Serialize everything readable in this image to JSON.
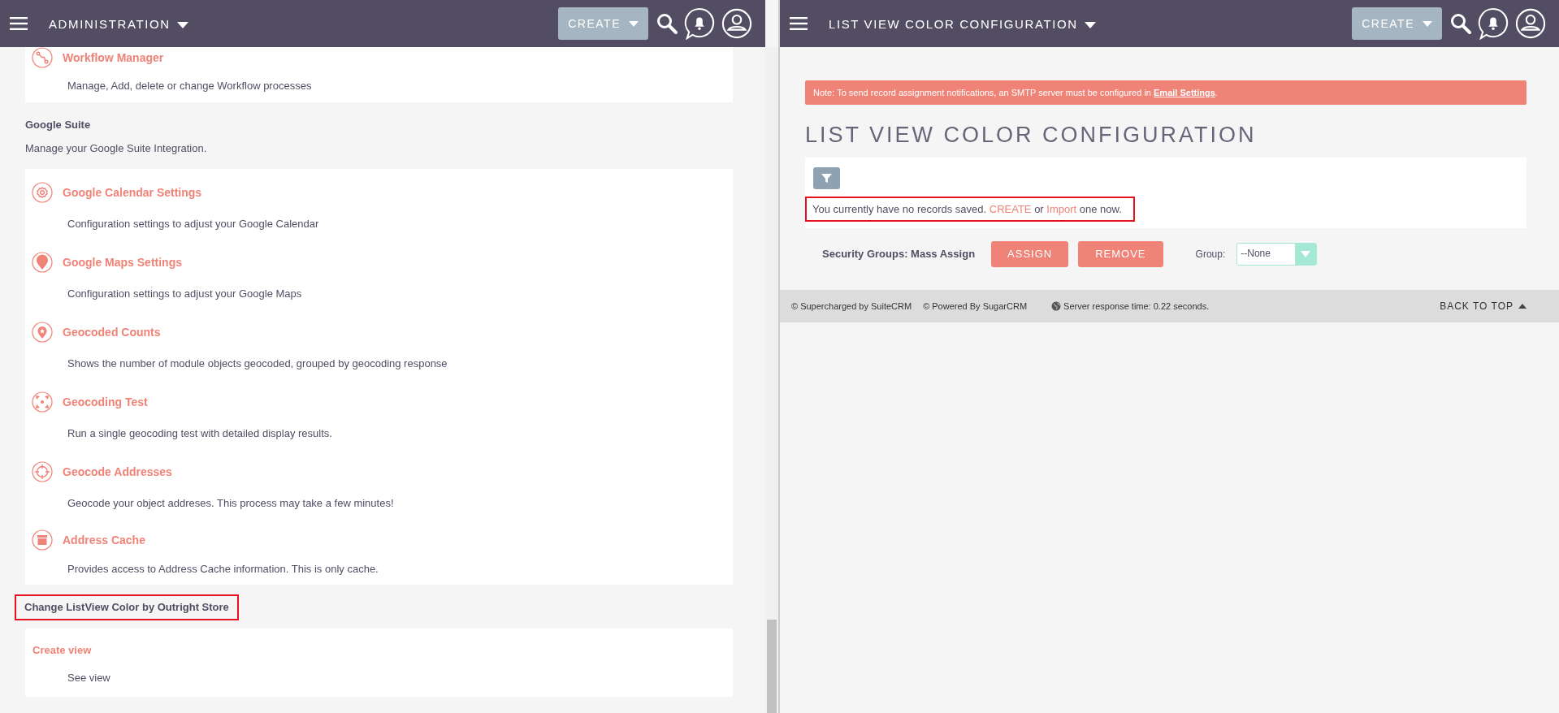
{
  "left": {
    "header": {
      "title": "ADMINISTRATION",
      "create": "CREATE"
    },
    "sections": [
      {
        "items": [
          {
            "kind": "workflow",
            "title": "Workflow Manager",
            "description": "Manage, Add, delete or change Workflow processes"
          }
        ]
      },
      {
        "title": "Google Suite",
        "description": "Manage your Google Suite Integration.",
        "items": [
          {
            "kind": "gear",
            "title": "Google Calendar Settings",
            "description": "Configuration settings to adjust your Google Calendar"
          },
          {
            "kind": "pin",
            "title": "Google Maps Settings",
            "description": "Configuration settings to adjust your Google Maps"
          },
          {
            "kind": "pin-star",
            "title": "Geocoded Counts",
            "description": "Shows the number of module objects geocoded, grouped by geocoding response"
          },
          {
            "kind": "arrows",
            "title": "Geocoding Test",
            "description": "Run a single geocoding test with detailed display results."
          },
          {
            "kind": "crosshair",
            "title": "Geocode Addresses",
            "description": "Geocode your object addreses. This process may take a few minutes!"
          },
          {
            "kind": "box",
            "title": "Address Cache",
            "description": "Provides access to Address Cache information. This is only cache."
          }
        ]
      },
      {
        "title": "Change ListView Color by Outright Store",
        "highlighted": true,
        "items": [
          {
            "kind": "none",
            "title": "Create view",
            "description": "See view"
          }
        ]
      }
    ]
  },
  "right": {
    "header": {
      "title": "LIST VIEW COLOR CONFIGURATION",
      "create": "CREATE"
    },
    "note": {
      "text": "Note: To send record assignment notifications, an SMTP server must be configured in ",
      "link": "Email Settings",
      "end": "."
    },
    "title": "LIST VIEW COLOR CONFIGURATION",
    "empty_message": {
      "highlighted": true,
      "parts": [
        {
          "kind": "text",
          "text": "You currently have no records saved. "
        },
        {
          "kind": "link",
          "text": "CREATE"
        },
        {
          "kind": "text",
          "text": " or "
        },
        {
          "kind": "link",
          "text": "Import"
        },
        {
          "kind": "text",
          "text": " one now."
        }
      ]
    },
    "mass_assign": {
      "label": "Security Groups: Mass Assign",
      "buttons": [
        "ASSIGN",
        "REMOVE"
      ],
      "group_label": "Group:",
      "group_value": "--None"
    },
    "footer": {
      "credits": [
        "© Supercharged by SuiteCRM",
        "© Powered By SugarCRM"
      ],
      "server_time": "Server response time: 0.22 seconds.",
      "back_to_top": "BACK TO TOP"
    }
  }
}
